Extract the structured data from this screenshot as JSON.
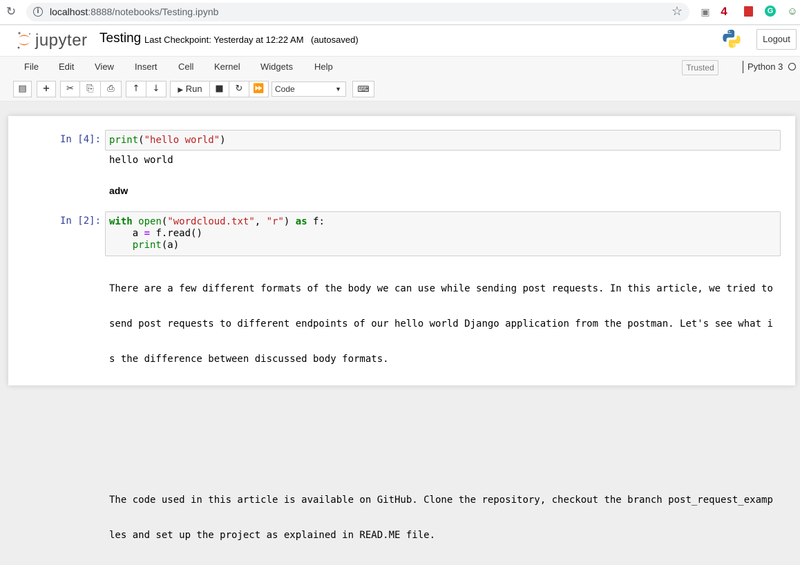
{
  "browser": {
    "url_host": "localhost",
    "url_path": ":8888/notebooks/Testing.ipynb",
    "extension_badge": "4"
  },
  "header": {
    "logo_text": "jupyter",
    "title": "Testing",
    "checkpoint": "Last Checkpoint: Yesterday at 12:22 AM",
    "autosave": "(autosaved)",
    "logout_label": "Logout"
  },
  "menubar": {
    "items": [
      "File",
      "Edit",
      "View",
      "Insert",
      "Cell",
      "Kernel",
      "Widgets",
      "Help"
    ],
    "trusted_label": "Trusted",
    "kernel_name": "Python 3"
  },
  "toolbar": {
    "run_label": "Run",
    "cell_type": "Code"
  },
  "cells": {
    "c1": {
      "prompt": "In [4]:",
      "code_line1": [
        "print",
        "(",
        "\"hello world\"",
        ")"
      ],
      "output": "hello world"
    },
    "markdown": {
      "text": "adw"
    },
    "c2": {
      "prompt": "In [2]:",
      "code_line1": [
        "with",
        " ",
        "open",
        "(",
        "\"wordcloud.txt\"",
        ", ",
        "\"r\"",
        ") ",
        "as",
        " f:"
      ],
      "code_line2": [
        "    a ",
        "=",
        " f.read()"
      ],
      "code_line3": [
        "    ",
        "print",
        "(a)"
      ],
      "output": [
        "There are a few different formats of the body we can use while sending post requests. In this article, we tried to",
        "send post requests to different endpoints of our hello world Django application from the postman. Let's see what i",
        "s the difference between discussed body formats.",
        "",
        "",
        "",
        "The code used in this article is available on GitHub. Clone the repository, checkout the branch post_request_examp",
        "les and set up the project as explained in READ.ME file."
      ]
    }
  },
  "colors": {
    "prompt": "#303f9f",
    "keyword": "#008000",
    "string": "#ba2121",
    "operator": "#aa22ff",
    "logo_orange": "#f37726"
  }
}
